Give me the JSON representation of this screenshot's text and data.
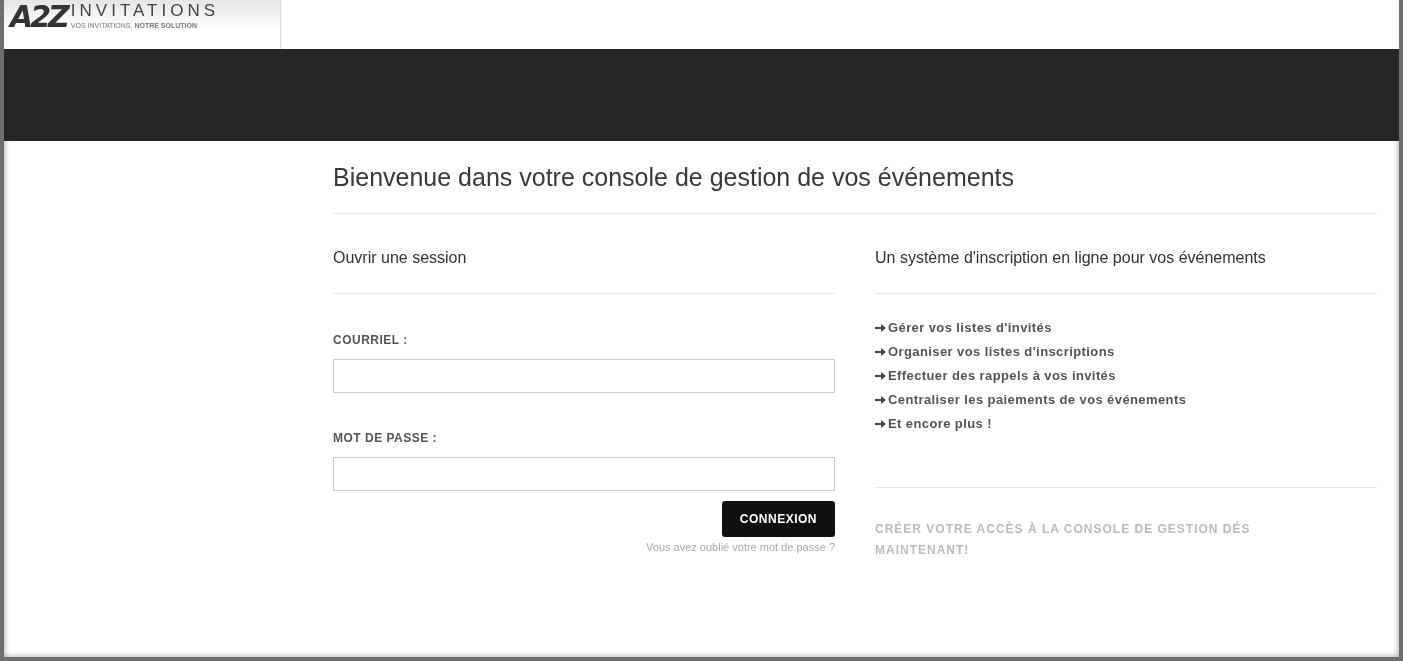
{
  "header": {
    "logo": {
      "mark": "A2Z",
      "name": "INVITATIONS",
      "tagline": "VOS INVITATIONS, **NOTRE SOLUTION**"
    }
  },
  "title": "Bienvenue dans votre console de gestion de vos événements",
  "login": {
    "heading": "Ouvrir une session",
    "fields": [
      {
        "label": "COURRIEL :"
      },
      {
        "label": "MOT DE PASSE :"
      }
    ],
    "button": "CONNEXION",
    "forgot": "Vous avez oublié votre mot de passe ?"
  },
  "info": {
    "heading": "Un système d'inscription en ligne pour vos événements",
    "features": [
      "Gérer vos listes d'invités",
      "Organiser vos listes d'inscriptions",
      "Effectuer des rappels à vos invités",
      "Centraliser les paiements de vos événements",
      "Et encore plus !"
    ],
    "signup": "CRÉER VOTRE ACCÈS À LA CONSOLE DE GESTION DÉS MAINTENANT!"
  }
}
